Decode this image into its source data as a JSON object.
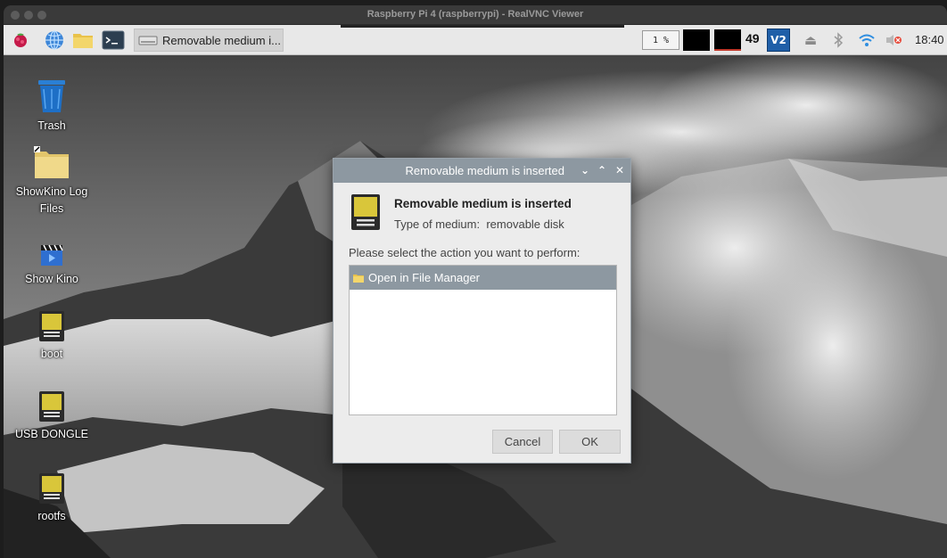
{
  "window": {
    "title": "Raspberry Pi 4 (raspberrypi) - RealVNC Viewer"
  },
  "taskbar": {
    "task_item_label": "Removable medium i...",
    "cpu_usage": "1 %",
    "temperature": "49",
    "vnc_label": "V2",
    "clock": "18:40",
    "icons": [
      "raspberry-menu-icon",
      "web-browser-icon",
      "file-manager-icon",
      "terminal-icon",
      "eject-icon",
      "bluetooth-icon",
      "wifi-icon",
      "volume-muted-icon"
    ]
  },
  "desktop": {
    "icons": [
      {
        "label": "Trash",
        "icon": "trash-icon"
      },
      {
        "label": "ShowKino Log Files",
        "icon": "folder-icon"
      },
      {
        "label": "Show Kino",
        "icon": "video-clapper-icon"
      },
      {
        "label": "boot",
        "icon": "sd-card-icon"
      },
      {
        "label": "USB DONGLE",
        "icon": "sd-card-icon"
      },
      {
        "label": "rootfs",
        "icon": "sd-card-icon"
      }
    ]
  },
  "dialog": {
    "title": "Removable medium is inserted",
    "heading": "Removable medium is inserted",
    "type_label": "Type of medium:",
    "type_value": "removable disk",
    "prompt": "Please select the action you want to perform:",
    "actions": [
      "Open in File Manager"
    ],
    "cancel_label": "Cancel",
    "ok_label": "OK",
    "colors": {
      "titlebar": "#8d98a1",
      "selection": "#8d98a1"
    }
  }
}
